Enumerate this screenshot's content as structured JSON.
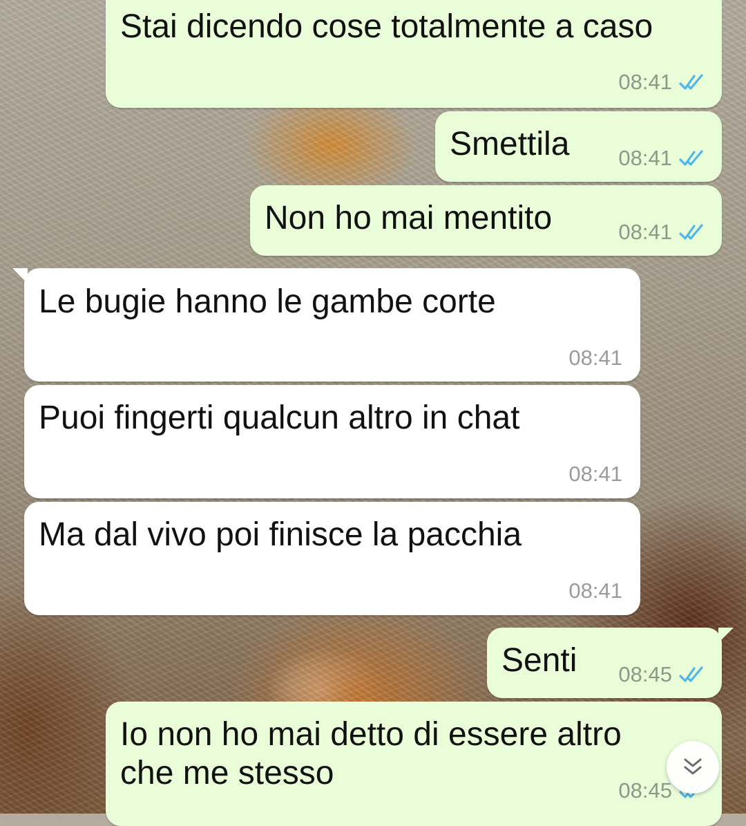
{
  "messages": [
    {
      "direction": "outgoing",
      "text": "Stai dicendo cose totalmente a caso",
      "time": "08:41",
      "status": "read"
    },
    {
      "direction": "outgoing",
      "text": "Smettila",
      "time": "08:41",
      "status": "read"
    },
    {
      "direction": "outgoing",
      "text": "Non ho mai mentito",
      "time": "08:41",
      "status": "read"
    },
    {
      "direction": "incoming",
      "text": "Le bugie hanno le gambe corte",
      "time": "08:41"
    },
    {
      "direction": "incoming",
      "text": "Puoi fingerti qualcun altro in chat",
      "time": "08:41"
    },
    {
      "direction": "incoming",
      "text": "Ma dal vivo poi finisce la pacchia",
      "time": "08:41"
    },
    {
      "direction": "outgoing",
      "text": "Senti",
      "time": "08:45",
      "status": "read"
    },
    {
      "direction": "outgoing",
      "text": "Io non ho mai detto di essere altro\nche me stesso",
      "time": "08:45",
      "status": "read"
    }
  ],
  "colors": {
    "outgoing_bubble": "#e8fdd8",
    "incoming_bubble": "#ffffff",
    "read_ticks": "#4fb6ec"
  },
  "icons": {
    "read_receipt": "double-check-icon",
    "scroll_down": "double-chevron-down-icon"
  }
}
